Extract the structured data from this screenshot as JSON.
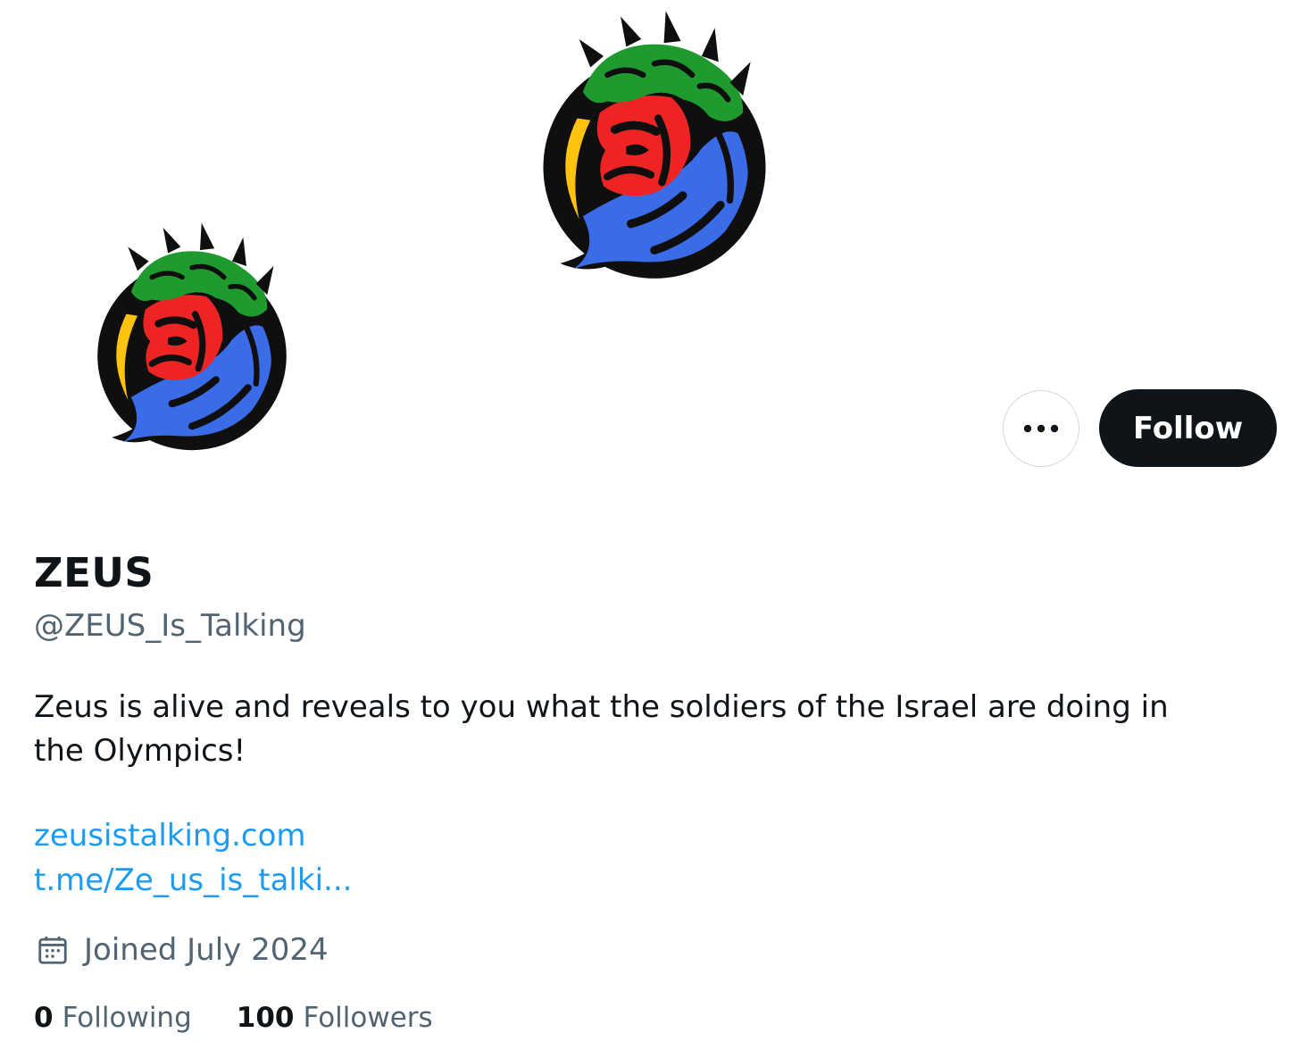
{
  "profile": {
    "display_name": "ZEUS",
    "handle": "@ZEUS_Is_Talking",
    "bio": "Zeus is alive and reveals to you what the soldiers of the Israel are doing in the Olympics!",
    "links": [
      "zeusistalking.com",
      "t.me/Ze_us_is_talki..."
    ],
    "joined": "Joined July 2024",
    "following_count": "0",
    "following_label": "Following",
    "followers_count": "100",
    "followers_label": "Followers"
  },
  "actions": {
    "follow_label": "Follow",
    "more_icon": "more-horizontal-icon"
  },
  "icons": {
    "joined": "calendar-icon",
    "logo": "zeus-head-logo"
  },
  "colors": {
    "text": "#0f1419",
    "secondary": "#536471",
    "link": "#1d9bf0",
    "follow_bg": "#0f1419",
    "border": "#cfd9de",
    "logo_green": "#1e9a2f",
    "logo_red": "#ee2424",
    "logo_blue": "#3a6ce8",
    "logo_yellow": "#ffc20e"
  }
}
